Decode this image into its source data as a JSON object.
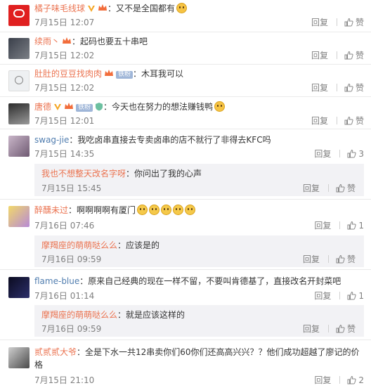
{
  "comments": [
    {
      "user": "橘子味毛线球",
      "text": "：又不是全国都有",
      "time": "7月15日 12:07",
      "reply": "回复",
      "like": "赞"
    },
    {
      "user": "续雨丶",
      "text": "：起码也要五十串吧",
      "time": "7月15日 12:02",
      "reply": "回复",
      "like": "赞"
    },
    {
      "user": "肚肚的豆豆找肉肉",
      "tie": "铁粉",
      "text": "：木耳我可以",
      "time": "7月15日 12:02",
      "reply": "回复",
      "like": "赞"
    },
    {
      "user": "唐德",
      "tie": "铁粉",
      "text": "：今天也在努力的想法赚钱鸭",
      "time": "7月15日 12:01",
      "reply": "回复",
      "like": "赞"
    },
    {
      "user": "swag-jie",
      "text": "：我吃卤串直接去专卖卤串的店不就行了非得去KFC吗",
      "time": "7月15日 14:35",
      "reply": "回复",
      "like": "3",
      "sub": {
        "user": "我也不想整天改名字呀",
        "text": "：你问出了我的心声",
        "time": "7月15日 15:45",
        "reply": "回复",
        "like": "赞"
      }
    },
    {
      "user": "醉醺未过",
      "text": "：啊啊啊啊有厦门",
      "time": "7月16日 07:46",
      "reply": "回复",
      "like": "1",
      "sub": {
        "user": "摩羯座的萌萌哒么么",
        "text": "：应该是的",
        "time": "7月16日 09:59",
        "reply": "回复",
        "like": "赞"
      }
    },
    {
      "user": "flame-blue",
      "text": "：原来自己经典的现在一样不留，不要叫肯德基了，直接改名开封菜吧",
      "time": "7月16日 01:14",
      "reply": "回复",
      "like": "1",
      "sub": {
        "user": "摩羯座的萌萌哒么么",
        "text": "：就是应该这样的",
        "time": "7月16日 09:59",
        "reply": "回复",
        "like": "赞"
      }
    },
    {
      "user": "贰贰贰大爷",
      "text": "：全是下水一共12串卖你们60你们还高高兴兴？？他们成功超越了廖记的价格",
      "time": "7月15日 21:10",
      "reply": "回复",
      "like": "2"
    }
  ],
  "icons": {
    "like": "thumbs-up-icon",
    "verified": "v-badge-icon",
    "crown": "crown-icon",
    "shield": "shield-icon",
    "emoji": "emoji-icon"
  }
}
